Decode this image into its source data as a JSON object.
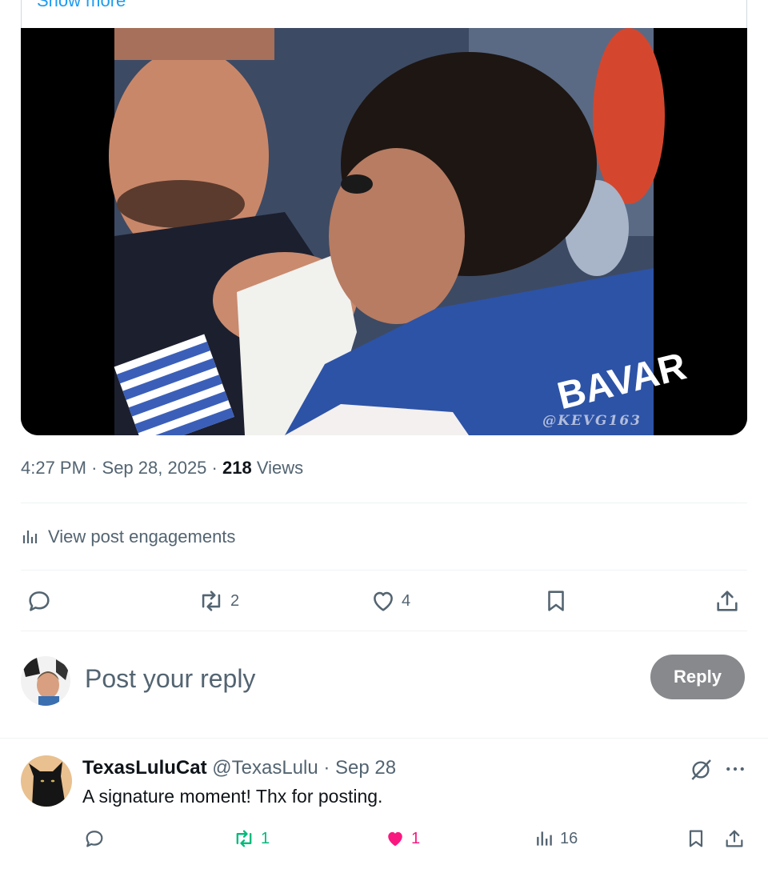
{
  "quoted_post": {
    "show_more": "Show more"
  },
  "media": {
    "watermark": "@KEVG163",
    "jersey_text": "BAVAR"
  },
  "post_meta": {
    "time": "4:27 PM",
    "date": "Sep 28, 2025",
    "views_count": "218",
    "views_label": "Views",
    "separator": "·"
  },
  "engagements": {
    "label": "View post engagements",
    "icon": "bar-chart-icon"
  },
  "actions": {
    "reply": {
      "icon": "reply-icon",
      "count": ""
    },
    "retweet": {
      "icon": "retweet-icon",
      "count": "2"
    },
    "like": {
      "icon": "heart-icon",
      "count": "4"
    },
    "bookmark": {
      "icon": "bookmark-icon"
    },
    "share": {
      "icon": "share-icon"
    }
  },
  "compose": {
    "placeholder": "Post your reply",
    "button_label": "Reply"
  },
  "reply": {
    "name": "TexasLuluCat",
    "handle": "@TexasLulu",
    "separator": "·",
    "date": "Sep 28",
    "text": "A signature moment!  Thx for posting.",
    "retweets": "1",
    "likes": "1",
    "views": "16",
    "colors": {
      "retweet_active": "#00ba7c",
      "like_active": "#f91880"
    }
  },
  "colors": {
    "text_primary": "#0f1419",
    "text_secondary": "#536471",
    "link": "#1d9bf0",
    "reply_button_bg": "#87898c"
  }
}
